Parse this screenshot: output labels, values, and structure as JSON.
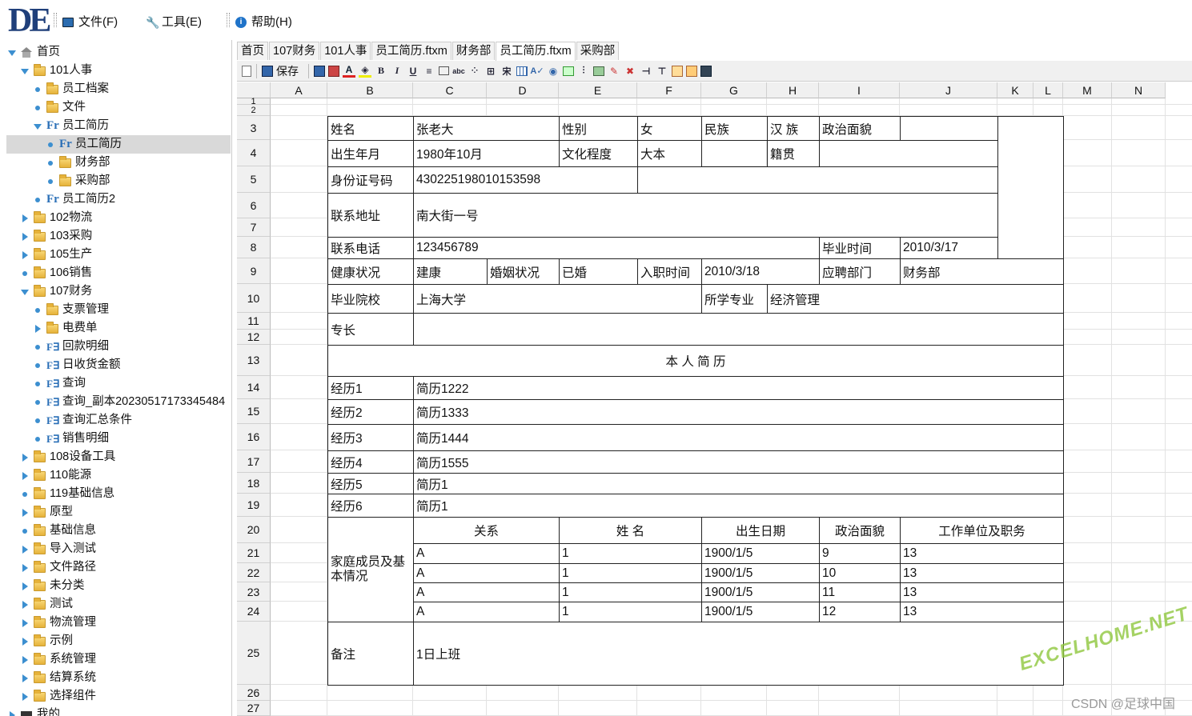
{
  "app": {
    "logo": "DE"
  },
  "menu": [
    {
      "label": "文件(F)",
      "icon": "computer-icon"
    },
    {
      "label": "工具(E)",
      "icon": "wrench-icon"
    },
    {
      "label": "帮助(H)",
      "icon": "info-icon"
    }
  ],
  "tree": [
    {
      "label": "首页",
      "level": 0,
      "expander": "down",
      "icon": "home"
    },
    {
      "label": "101人事",
      "level": 1,
      "expander": "down",
      "icon": "folder"
    },
    {
      "label": "员工档案",
      "level": 2,
      "expander": "dot",
      "icon": "folder"
    },
    {
      "label": "文件",
      "level": 2,
      "expander": "dot",
      "icon": "folder"
    },
    {
      "label": "员工简历",
      "level": 2,
      "expander": "down",
      "icon": "report"
    },
    {
      "label": "员工简历",
      "level": 3,
      "expander": "dot",
      "icon": "report",
      "selected": true
    },
    {
      "label": "财务部",
      "level": 3,
      "expander": "dot",
      "icon": "folder"
    },
    {
      "label": "采购部",
      "level": 3,
      "expander": "dot",
      "icon": "folder"
    },
    {
      "label": "员工简历2",
      "level": 2,
      "expander": "dot",
      "icon": "report"
    },
    {
      "label": "102物流",
      "level": 1,
      "expander": "right",
      "icon": "folder"
    },
    {
      "label": "103采购",
      "level": 1,
      "expander": "right",
      "icon": "folder"
    },
    {
      "label": "105生产",
      "level": 1,
      "expander": "right",
      "icon": "folder"
    },
    {
      "label": "106销售",
      "level": 1,
      "expander": "dot",
      "icon": "folder"
    },
    {
      "label": "107财务",
      "level": 1,
      "expander": "down",
      "icon": "folder"
    },
    {
      "label": "支票管理",
      "level": 2,
      "expander": "dot",
      "icon": "folder"
    },
    {
      "label": "电费单",
      "level": 2,
      "expander": "right",
      "icon": "folder"
    },
    {
      "label": "回款明细",
      "level": 2,
      "expander": "dot",
      "icon": "query"
    },
    {
      "label": "日收货金额",
      "level": 2,
      "expander": "dot",
      "icon": "query"
    },
    {
      "label": "查询",
      "level": 2,
      "expander": "dot",
      "icon": "query"
    },
    {
      "label": "查询_副本20230517173345484",
      "level": 2,
      "expander": "dot",
      "icon": "query"
    },
    {
      "label": "查询汇总条件",
      "level": 2,
      "expander": "dot",
      "icon": "query"
    },
    {
      "label": "销售明细",
      "level": 2,
      "expander": "dot",
      "icon": "query"
    },
    {
      "label": "108设备工具",
      "level": 1,
      "expander": "right",
      "icon": "folder"
    },
    {
      "label": "110能源",
      "level": 1,
      "expander": "right",
      "icon": "folder"
    },
    {
      "label": "119基础信息",
      "level": 1,
      "expander": "dot",
      "icon": "folder"
    },
    {
      "label": "原型",
      "level": 1,
      "expander": "right",
      "icon": "folder"
    },
    {
      "label": "基础信息",
      "level": 1,
      "expander": "dot",
      "icon": "folder"
    },
    {
      "label": "导入测试",
      "level": 1,
      "expander": "right",
      "icon": "folder"
    },
    {
      "label": "文件路径",
      "level": 1,
      "expander": "right",
      "icon": "folder"
    },
    {
      "label": "未分类",
      "level": 1,
      "expander": "right",
      "icon": "folder"
    },
    {
      "label": "测试",
      "level": 1,
      "expander": "right",
      "icon": "folder"
    },
    {
      "label": "物流管理",
      "level": 1,
      "expander": "right",
      "icon": "folder"
    },
    {
      "label": "示例",
      "level": 1,
      "expander": "right",
      "icon": "folder"
    },
    {
      "label": "系统管理",
      "level": 1,
      "expander": "right",
      "icon": "folder"
    },
    {
      "label": "结算系统",
      "level": 1,
      "expander": "right",
      "icon": "folder"
    },
    {
      "label": "选择组件",
      "level": 1,
      "expander": "right",
      "icon": "folder"
    },
    {
      "label": "我的",
      "level": 0,
      "expander": "right",
      "icon": "mine"
    }
  ],
  "tabs": [
    {
      "label": "首页",
      "active": false
    },
    {
      "label": "107财务",
      "active": false
    },
    {
      "label": "101人事",
      "active": false
    },
    {
      "label": "员工简历.ftxm",
      "active": false
    },
    {
      "label": "财务部",
      "active": false
    },
    {
      "label": "员工简历.ftxm",
      "active": true
    },
    {
      "label": "采购部",
      "active": false
    }
  ],
  "toolbar": {
    "save_label": "保存",
    "icons": [
      "page-icon",
      "save-icon",
      "save-as-icon",
      "copy-icon",
      "font-color-icon",
      "fill-color-icon",
      "bold-icon",
      "italic-icon",
      "underline-icon",
      "align-icon",
      "format-icon",
      "strikethrough-icon",
      "merge-icon",
      "border-icon",
      "font-icon",
      "table-icon",
      "spell-icon",
      "preview-icon",
      "insert-row-icon",
      "insert-col-icon",
      "image-icon",
      "edit-icon",
      "delete-icon",
      "split-icon",
      "tree-icon",
      "report-icon",
      "export-icon",
      "disk-icon"
    ]
  },
  "columns": [
    "A",
    "B",
    "C",
    "D",
    "E",
    "F",
    "G",
    "H",
    "I",
    "J",
    "K",
    "L",
    "M",
    "N"
  ],
  "rows": [
    "1",
    "2",
    "3",
    "4",
    "5",
    "6",
    "7",
    "8",
    "9",
    "10",
    "11",
    "12",
    "13",
    "14",
    "15",
    "16",
    "17",
    "18",
    "19",
    "20",
    "21",
    "22",
    "23",
    "24",
    "25",
    "26",
    "27"
  ],
  "form": {
    "name_label": "姓名",
    "name": "张老大",
    "sex_label": "性别",
    "sex": "女",
    "ethnic_label": "民族",
    "ethnic": "汉 族",
    "politics_label": "政治面貌",
    "politics": "",
    "birth_label": "出生年月",
    "birth": "1980年10月",
    "edu_label": "文化程度",
    "edu": "大本",
    "native_label": "籍贯",
    "native": "",
    "id_label": "身份证号码",
    "id": "430225198010153598",
    "addr_label": "联系地址",
    "addr": "南大街一号",
    "phone_label": "联系电话",
    "phone": "123456789",
    "grad_time_label": "毕业时间",
    "grad_time": "2010/3/17",
    "health_label": "健康状况",
    "health": "建康",
    "marriage_label": "婚姻状况",
    "marriage": "已婚",
    "join_label": "入职时间",
    "join": "2010/3/18",
    "dept_label": "应聘部门",
    "dept": "财务部",
    "school_label": "毕业院校",
    "school": "上海大学",
    "major_label": "所学专业",
    "major": "经济管理",
    "skill_label": "专长",
    "resume_title": "本 人 简 历",
    "resume": [
      {
        "label": "经历1",
        "value": "简历1222"
      },
      {
        "label": "经历2",
        "value": "简历1333"
      },
      {
        "label": "经历3",
        "value": "简历1444"
      },
      {
        "label": "经历4",
        "value": "简历1555"
      },
      {
        "label": "经历5",
        "value": "简历1"
      },
      {
        "label": "经历6",
        "value": "简历1"
      }
    ],
    "family_label": "家庭成员及基本情况",
    "family_headers": [
      "关系",
      "姓  名",
      "出生日期",
      "政治面貌",
      "工作单位及职务"
    ],
    "family": [
      [
        "A",
        "1",
        "1900/1/5",
        "9",
        "13"
      ],
      [
        "A",
        "1",
        "1900/1/5",
        "10",
        "13"
      ],
      [
        "A",
        "1",
        "1900/1/5",
        "11",
        "13"
      ],
      [
        "A",
        "1",
        "1900/1/5",
        "12",
        "13"
      ]
    ],
    "remark_label": "备注",
    "remark": "1日上班"
  },
  "watermark": {
    "site": "EXCELHOME.NET",
    "credit": "CSDN @足球中国"
  }
}
